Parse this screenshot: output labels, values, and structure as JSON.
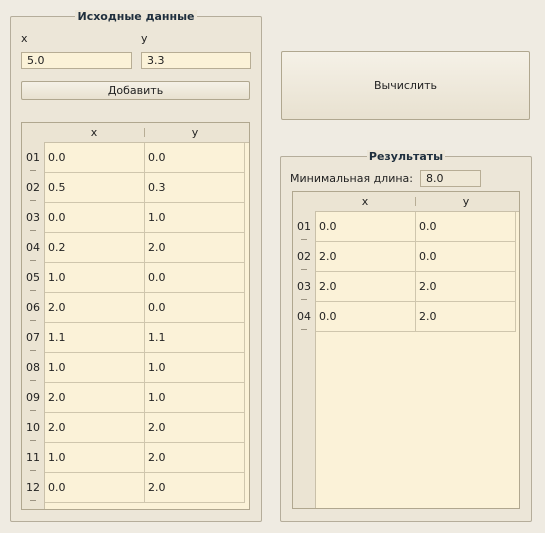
{
  "input_group": {
    "title": "Исходные данные",
    "x_label": "x",
    "y_label": "y",
    "x_value": "5.0",
    "y_value": "3.3",
    "add_button": "Добавить"
  },
  "compute_button": "Вычислить",
  "input_table": {
    "col_x": "x",
    "col_y": "y",
    "rows": [
      {
        "num": "01",
        "x": "0.0",
        "y": "0.0"
      },
      {
        "num": "02",
        "x": "0.5",
        "y": "0.3"
      },
      {
        "num": "03",
        "x": "0.0",
        "y": "1.0"
      },
      {
        "num": "04",
        "x": "0.2",
        "y": "2.0"
      },
      {
        "num": "05",
        "x": "1.0",
        "y": "0.0"
      },
      {
        "num": "06",
        "x": "2.0",
        "y": "0.0"
      },
      {
        "num": "07",
        "x": "1.1",
        "y": "1.1"
      },
      {
        "num": "08",
        "x": "1.0",
        "y": "1.0"
      },
      {
        "num": "09",
        "x": "2.0",
        "y": "1.0"
      },
      {
        "num": "10",
        "x": "2.0",
        "y": "2.0"
      },
      {
        "num": "11",
        "x": "1.0",
        "y": "2.0"
      },
      {
        "num": "12",
        "x": "0.0",
        "y": "2.0"
      }
    ]
  },
  "results_group": {
    "title": "Результаты",
    "min_length_label": "Минимальная длина:",
    "min_length_value": "8.0",
    "col_x": "x",
    "col_y": "y",
    "rows": [
      {
        "num": "01",
        "x": "0.0",
        "y": "0.0"
      },
      {
        "num": "02",
        "x": "2.0",
        "y": "0.0"
      },
      {
        "num": "03",
        "x": "2.0",
        "y": "2.0"
      },
      {
        "num": "04",
        "x": "0.0",
        "y": "2.0"
      }
    ]
  }
}
